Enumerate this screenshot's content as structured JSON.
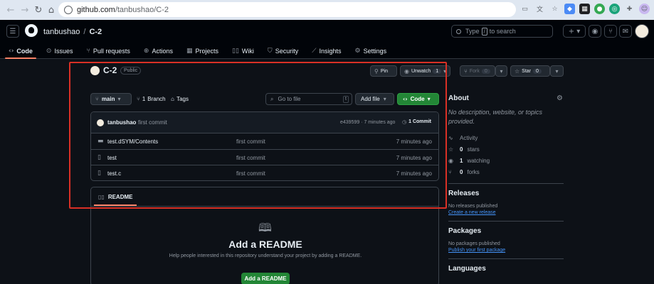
{
  "browser": {
    "url_host": "github.com",
    "url_path": "/tanbushao/C-2"
  },
  "header": {
    "owner": "tanbushao",
    "separator": "/",
    "repo": "C-2",
    "search_label": "Type",
    "search_key": "/",
    "search_suffix": "to search",
    "plus": "+",
    "tabs": [
      {
        "label": "Code",
        "icon": "code-icon"
      },
      {
        "label": "Issues",
        "icon": "issue-icon"
      },
      {
        "label": "Pull requests",
        "icon": "pull-request-icon"
      },
      {
        "label": "Actions",
        "icon": "play-icon"
      },
      {
        "label": "Projects",
        "icon": "table-icon"
      },
      {
        "label": "Wiki",
        "icon": "book-icon"
      },
      {
        "label": "Security",
        "icon": "shield-icon"
      },
      {
        "label": "Insights",
        "icon": "graph-icon"
      },
      {
        "label": "Settings",
        "icon": "gear-icon"
      }
    ]
  },
  "repo": {
    "name": "C-2",
    "visibility": "Public",
    "pin_label": "Pin",
    "unwatch_label": "Unwatch",
    "watch_count": "1",
    "fork_label": "Fork",
    "fork_count": "0",
    "star_label": "Star",
    "star_count": "0"
  },
  "toolbar": {
    "branch": "main",
    "branch_count": "1",
    "branch_word": "Branch",
    "tags_label": "Tags",
    "goto_placeholder": "Go to file",
    "goto_key": "t",
    "add_file": "Add file",
    "code": "Code"
  },
  "commit": {
    "user": "tanbushao",
    "message": "first commit",
    "sha_time": "e439599 · 7 minutes ago",
    "count": "1 Commit"
  },
  "files": [
    {
      "name": "test.dSYM/Contents",
      "type": "folder",
      "message": "first commit",
      "age": "7 minutes ago"
    },
    {
      "name": "test",
      "type": "file",
      "message": "first commit",
      "age": "7 minutes ago"
    },
    {
      "name": "test.c",
      "type": "file",
      "message": "first commit",
      "age": "7 minutes ago"
    }
  ],
  "readme": {
    "tab": "README",
    "title": "Add a README",
    "description": "Help people interested in this repository understand your project by adding a README.",
    "button": "Add a README"
  },
  "sidebar": {
    "about_title": "About",
    "about_desc": "No description, website, or topics provided.",
    "activity": "Activity",
    "stars_count": "0",
    "stars_label": "stars",
    "watching_count": "1",
    "watching_label": "watching",
    "forks_count": "0",
    "forks_label": "forks",
    "releases_title": "Releases",
    "releases_none": "No releases published",
    "releases_link": "Create a new release",
    "packages_title": "Packages",
    "packages_none": "No packages published",
    "packages_link": "Publish your first package",
    "languages_title": "Languages"
  },
  "colors": {
    "accent_green": "#238636",
    "tab_underline": "#f78166",
    "link": "#4493f8",
    "annotation": "#d93025"
  }
}
